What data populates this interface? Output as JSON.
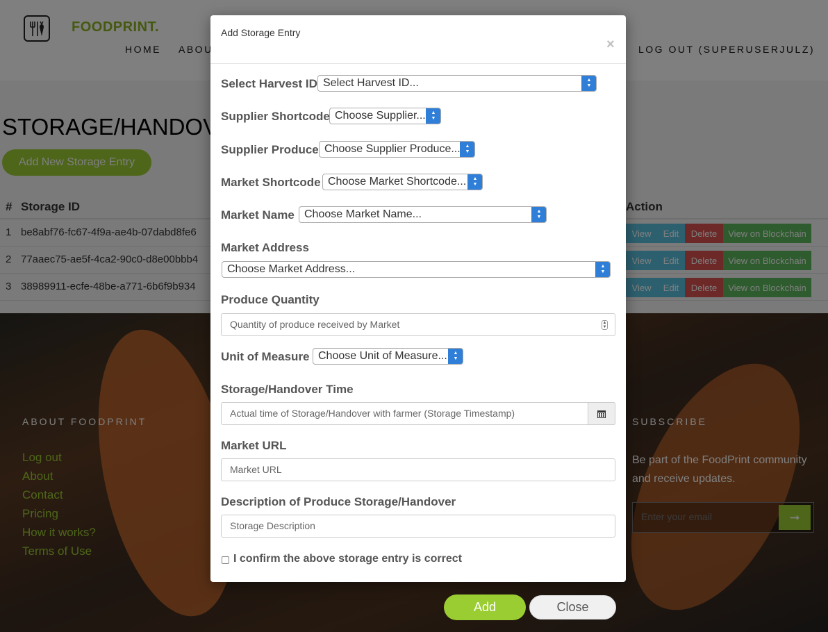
{
  "header": {
    "brand": "FOODPRINT.",
    "nav": [
      "HOME",
      "ABOU",
      "LOG OUT (SUPERUSERJULZ)"
    ]
  },
  "page": {
    "title": "STORAGE/HANDOVE",
    "add_button": "Add New Storage Entry",
    "table": {
      "columns": [
        "#",
        "Storage ID",
        "Action"
      ],
      "rows": [
        {
          "num": "1",
          "id": "be8abf76-fc67-4f9a-ae4b-07dabd8fe6"
        },
        {
          "num": "2",
          "id": "77aaec75-ae5f-4ca2-90c0-d8e00bbb4"
        },
        {
          "num": "3",
          "id": "38989911-ecfe-48be-a771-6b6f9b934"
        }
      ],
      "actions": {
        "view": "View",
        "edit": "Edit",
        "delete": "Delete",
        "blockchain": "View on Blockchain"
      }
    }
  },
  "footer": {
    "about_title": "ABOUT FOODPRINT",
    "links": [
      "Log out",
      "About",
      "Contact",
      "Pricing",
      "How it works?",
      "Terms of Use"
    ],
    "subscribe_title": "SUBSCRIBE",
    "subscribe_text": "Be part of the FoodPrint community and receive updates.",
    "email_placeholder": "Enter your email",
    "subscribe_arrow": "➞"
  },
  "modal": {
    "title": "Add Storage Entry",
    "close_x": "×",
    "fields": {
      "harvest_id": {
        "label": "Select Harvest ID",
        "value": "Select Harvest ID..."
      },
      "supplier_shortcode": {
        "label": "Supplier Shortcode",
        "value": "Choose Supplier..."
      },
      "supplier_produce": {
        "label": "Supplier Produce",
        "value": "Choose Supplier Produce..."
      },
      "market_shortcode": {
        "label": "Market Shortcode",
        "value": "Choose Market Shortcode..."
      },
      "market_name": {
        "label": "Market Name",
        "value": "Choose Market Name..."
      },
      "market_address": {
        "label": "Market Address",
        "value": "Choose Market Address..."
      },
      "produce_quantity": {
        "label": "Produce Quantity",
        "placeholder": "Quantity of produce received by Market"
      },
      "unit_of_measure": {
        "label": "Unit of Measure",
        "value": "Choose Unit of Measure..."
      },
      "storage_time": {
        "label": "Storage/Handover Time",
        "placeholder": "Actual time of Storage/Handover with farmer (Storage Timestamp)"
      },
      "market_url": {
        "label": "Market URL",
        "placeholder": "Market URL"
      },
      "description": {
        "label": "Description of Produce Storage/Handover",
        "placeholder": "Storage Description"
      }
    },
    "confirm_label": "I confirm the above storage entry is correct",
    "add_button": "Add",
    "close_button": "Close"
  },
  "colors": {
    "brand_green": "#9acd32",
    "select_blue": "#2f7ed8",
    "view_blue": "#5bc0de",
    "delete_red": "#d9534f",
    "blockchain_green": "#5cb85c"
  }
}
